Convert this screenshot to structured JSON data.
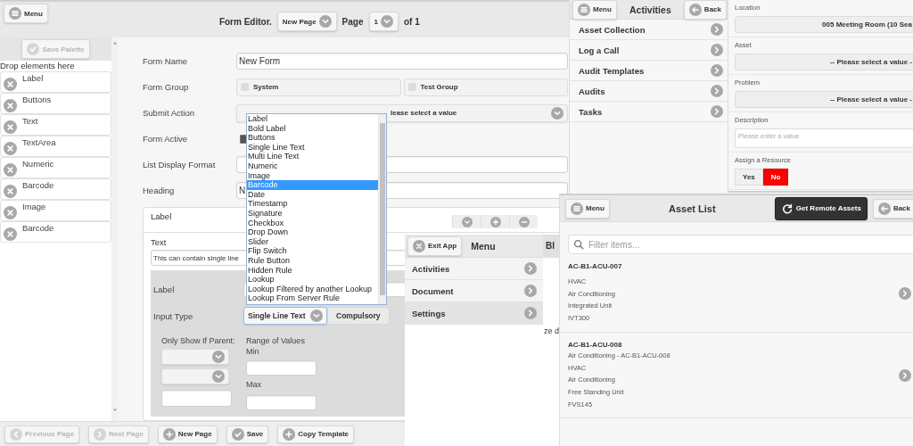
{
  "form_editor": {
    "menu_button": {
      "label": "Menu"
    },
    "title": "Form Editor.",
    "page_select": "New Page",
    "page_label": "Page",
    "page_number": "1",
    "page_total": "of 1",
    "palette": {
      "save_button": {
        "label": "Save Palette",
        "disabled": true
      },
      "hint": "Drop elements here",
      "items": [
        "Label",
        "Buttons",
        "Text",
        "TextArea",
        "Numeric",
        "Barcode",
        "Image",
        "Barcode"
      ]
    },
    "fields": [
      {
        "label": "Form Name",
        "kind": "text",
        "value": "New Form"
      },
      {
        "label": "Form Group",
        "kind": "checkboxes",
        "options": [
          {
            "label": "System",
            "checked": false
          },
          {
            "label": "Test Group",
            "checked": false
          }
        ]
      },
      {
        "label": "Submit Action",
        "kind": "select",
        "value": "lease select a value"
      },
      {
        "label": "Form Active",
        "kind": "checkbox",
        "checked": true
      },
      {
        "label": "List Display Format",
        "kind": "text"
      },
      {
        "label": "Heading",
        "kind": "text",
        "value": "N"
      }
    ],
    "element_card": {
      "title": "Label",
      "text_label": "Text",
      "text_value": "This can contain single line",
      "label_label": "Label",
      "input_type_label": "Input Type",
      "input_type": "Single Line Text",
      "compulsory": "Compulsory",
      "parent_label": "Only Show If Parent:",
      "range_label": "Range of Values",
      "min_label": "Min",
      "max_label": "Max"
    },
    "footer": [
      {
        "label": "Previous Page",
        "disabled": true
      },
      {
        "label": "Next Page",
        "disabled": true
      },
      {
        "label": "New Page",
        "disabled": false
      },
      {
        "label": "Save",
        "disabled": false
      },
      {
        "label": "Copy Template",
        "disabled": false
      }
    ]
  },
  "type_dropdown": {
    "options": [
      {
        "label": "Label",
        "selected": false
      },
      {
        "label": "Bold Label",
        "selected": false
      },
      {
        "label": "Buttons",
        "selected": false
      },
      {
        "label": "Single Line Text",
        "selected": false
      },
      {
        "label": "Multi Line Text",
        "selected": false
      },
      {
        "label": "Numeric",
        "selected": false
      },
      {
        "label": "Image",
        "selected": false
      },
      {
        "label": "Barcode",
        "selected": true
      },
      {
        "label": "Date",
        "selected": false
      },
      {
        "label": "Timestamp",
        "selected": false
      },
      {
        "label": "Signature",
        "selected": false
      },
      {
        "label": "Checkbox",
        "selected": false
      },
      {
        "label": "Drop Down",
        "selected": false
      },
      {
        "label": "Slider",
        "selected": false
      },
      {
        "label": "Flip Switch",
        "selected": false
      },
      {
        "label": "Rule Button",
        "selected": false
      },
      {
        "label": "Hidden Rule",
        "selected": false
      },
      {
        "label": "Lookup",
        "selected": false
      },
      {
        "label": "Lookup Filtered by another Lookup",
        "selected": false
      },
      {
        "label": "Lookup From Server Rule",
        "selected": false
      }
    ]
  },
  "activities_window": {
    "menu_button": {
      "label": "Menu"
    },
    "title": "Activities",
    "back_button": {
      "label": "Back"
    },
    "items": [
      "Asset Collection",
      "Log a Call",
      "Audit Templates",
      "Audits",
      "Tasks"
    ]
  },
  "resource_form": {
    "fields": [
      {
        "label": "Location",
        "kind": "select",
        "value": "005 Meeting Room (10 Sea"
      },
      {
        "label": "Asset",
        "kind": "select",
        "value": "-- Please select a value -"
      },
      {
        "label": "Problem",
        "kind": "select",
        "value": "-- Please select a value -"
      },
      {
        "label": "Description",
        "kind": "textarea",
        "placeholder": "Please enter a value"
      },
      {
        "label": "Assign a Resource",
        "kind": "toggle",
        "options": [
          {
            "label": "Yes",
            "selected": false
          },
          {
            "label": "No",
            "selected": true
          }
        ]
      }
    ]
  },
  "background_window": {
    "header": "Bl",
    "text": "ze d"
  },
  "menu_window": {
    "exit_button": {
      "label": "Exit App"
    },
    "title": "Menu",
    "items": [
      {
        "label": "Activities",
        "selected": false
      },
      {
        "label": "Document",
        "selected": false
      },
      {
        "label": "Settings",
        "selected": true
      }
    ]
  },
  "asset_list": {
    "menu_button": {
      "label": "Menu"
    },
    "title": "Asset List",
    "remote_button": {
      "label": "Get Remote Assets"
    },
    "back_button": {
      "label": "Back"
    },
    "filter_placeholder": "Filter items...",
    "items": [
      {
        "title": "AC-B1-ACU-007",
        "lines": [
          "HVAC",
          "Air Conditioning",
          "Integrated Unit",
          "IVT300"
        ]
      },
      {
        "title": "AC-B1-ACU-008",
        "lines": [
          "Air Conditioning - AC-B1-ACU-008",
          "HVAC",
          "Air Conditioning",
          "Free Standing Unit",
          "FVS145"
        ]
      }
    ]
  }
}
